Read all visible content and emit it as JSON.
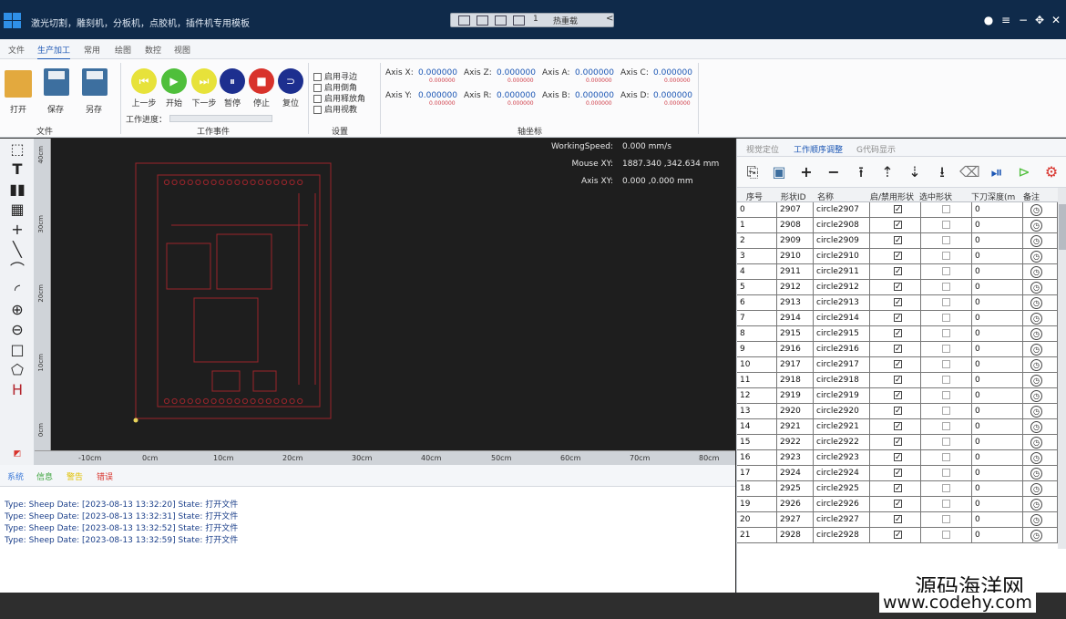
{
  "window": {
    "title": "激光切割，雕刻机，分板机，点胶机，插件机专用模板",
    "quick_count": "1",
    "quick_reload": "热重载",
    "quick_collapse": "<"
  },
  "menu": [
    "文件",
    "生产加工",
    "常用",
    "绘图",
    "数控",
    "视图"
  ],
  "menu_active": "生产加工",
  "ribbon": {
    "file_group": {
      "label": "文件",
      "buttons": [
        "打开",
        "保存",
        "另存"
      ]
    },
    "work_group": {
      "label": "工作事件",
      "buttons": [
        {
          "label": "上一步",
          "icon": "skip-back-icon",
          "color": "#e7e23a"
        },
        {
          "label": "开始",
          "icon": "play-icon",
          "color": "#4fbf3b"
        },
        {
          "label": "下一步",
          "icon": "skip-forward-icon",
          "color": "#e7e23a"
        },
        {
          "label": "暂停",
          "icon": "pause-icon",
          "color": "#1d2f8f"
        },
        {
          "label": "停止",
          "icon": "stop-icon",
          "color": "#d8322b"
        },
        {
          "label": "复位",
          "icon": "reset-icon",
          "color": "#1d2f8f"
        }
      ],
      "progress_label": "工作进度：",
      "progress": 0
    },
    "settings_group": {
      "label": "设置",
      "options": [
        "启用寻边",
        "启用倒角",
        "启用释放角",
        "启用视教"
      ]
    },
    "axis_group": {
      "label": "轴坐标",
      "axes": [
        {
          "name": "Axis X:",
          "value": "0.000000",
          "sub": "0.000000"
        },
        {
          "name": "Axis Z:",
          "value": "0.000000",
          "sub": "0.000000"
        },
        {
          "name": "Axis A:",
          "value": "0.000000",
          "sub": "0.000000"
        },
        {
          "name": "Axis C:",
          "value": "0.000000",
          "sub": "0.000000"
        },
        {
          "name": "Axis Y:",
          "value": "0.000000",
          "sub": "0.000000"
        },
        {
          "name": "Axis R:",
          "value": "0.000000",
          "sub": "0.000000"
        },
        {
          "name": "Axis B:",
          "value": "0.000000",
          "sub": "0.000000"
        },
        {
          "name": "Axis D:",
          "value": "0.000000",
          "sub": "0.000000"
        }
      ]
    }
  },
  "left_tools": [
    "select-icon",
    "text-icon",
    "barcode-icon",
    "qrcode-icon",
    "point-icon",
    "line-icon",
    "polyline-icon",
    "arc-icon",
    "circle-icon",
    "ellipse-icon",
    "rectangle-icon",
    "polygon-icon",
    "dimension-icon"
  ],
  "canvas": {
    "hud": [
      {
        "key": "WorkingSpeed:",
        "value": "0.000 mm/s"
      },
      {
        "key": "Mouse XY:",
        "value": "1887.340 ,342.634 mm"
      },
      {
        "key": "Axis XY:",
        "value": "0.000 ,0.000 mm"
      }
    ],
    "h_ruler": [
      "-10cm",
      "0cm",
      "10cm",
      "20cm",
      "30cm",
      "40cm",
      "50cm",
      "60cm",
      "70cm",
      "80cm"
    ],
    "v_ruler": [
      "40cm",
      "30cm",
      "20cm",
      "10cm",
      "0cm"
    ]
  },
  "log": {
    "tabs": [
      {
        "label": "系统",
        "color": "#3a78d8"
      },
      {
        "label": "信息",
        "color": "#3aa33a"
      },
      {
        "label": "警告",
        "color": "#e0c000"
      },
      {
        "label": "错误",
        "color": "#d8322b"
      }
    ],
    "lines": [
      "Type: Sheep  Date: [2023-08-13 13:32:20]  State: 打开文件",
      "Type: Sheep  Date: [2023-08-13 13:32:31]  State: 打开文件",
      "Type: Sheep  Date: [2023-08-13 13:32:52]  State: 打开文件",
      "Type: Sheep  Date: [2023-08-13 13:32:59]  State: 打开文件"
    ]
  },
  "right_panel": {
    "tabs": [
      "视觉定位",
      "工作顺序调整",
      "G代码显示"
    ],
    "active_tab": "工作顺序调整",
    "tools": [
      "new-icon",
      "save-icon",
      "plus-icon",
      "minus-icon",
      "move-top-icon",
      "move-up-icon",
      "move-down-icon",
      "move-bottom-icon",
      "eraser-icon",
      "step-icon",
      "run-icon",
      "settings-icon"
    ],
    "columns": [
      "序号",
      "形状ID",
      "名称",
      "启/禁用形状",
      "选中形状",
      "下刀深度(m",
      "备注"
    ],
    "rows": [
      {
        "idx": "0",
        "id": "2907",
        "name": "circle2907",
        "enabled": true,
        "selected": false,
        "depth": "0"
      },
      {
        "idx": "1",
        "id": "2908",
        "name": "circle2908",
        "enabled": true,
        "selected": false,
        "depth": "0"
      },
      {
        "idx": "2",
        "id": "2909",
        "name": "circle2909",
        "enabled": true,
        "selected": false,
        "depth": "0"
      },
      {
        "idx": "3",
        "id": "2910",
        "name": "circle2910",
        "enabled": true,
        "selected": false,
        "depth": "0"
      },
      {
        "idx": "4",
        "id": "2911",
        "name": "circle2911",
        "enabled": true,
        "selected": false,
        "depth": "0"
      },
      {
        "idx": "5",
        "id": "2912",
        "name": "circle2912",
        "enabled": true,
        "selected": false,
        "depth": "0"
      },
      {
        "idx": "6",
        "id": "2913",
        "name": "circle2913",
        "enabled": true,
        "selected": false,
        "depth": "0"
      },
      {
        "idx": "7",
        "id": "2914",
        "name": "circle2914",
        "enabled": true,
        "selected": false,
        "depth": "0"
      },
      {
        "idx": "8",
        "id": "2915",
        "name": "circle2915",
        "enabled": true,
        "selected": false,
        "depth": "0"
      },
      {
        "idx": "9",
        "id": "2916",
        "name": "circle2916",
        "enabled": true,
        "selected": false,
        "depth": "0"
      },
      {
        "idx": "10",
        "id": "2917",
        "name": "circle2917",
        "enabled": true,
        "selected": false,
        "depth": "0"
      },
      {
        "idx": "11",
        "id": "2918",
        "name": "circle2918",
        "enabled": true,
        "selected": false,
        "depth": "0"
      },
      {
        "idx": "12",
        "id": "2919",
        "name": "circle2919",
        "enabled": true,
        "selected": false,
        "depth": "0"
      },
      {
        "idx": "13",
        "id": "2920",
        "name": "circle2920",
        "enabled": true,
        "selected": false,
        "depth": "0"
      },
      {
        "idx": "14",
        "id": "2921",
        "name": "circle2921",
        "enabled": true,
        "selected": false,
        "depth": "0"
      },
      {
        "idx": "15",
        "id": "2922",
        "name": "circle2922",
        "enabled": true,
        "selected": false,
        "depth": "0"
      },
      {
        "idx": "16",
        "id": "2923",
        "name": "circle2923",
        "enabled": true,
        "selected": false,
        "depth": "0"
      },
      {
        "idx": "17",
        "id": "2924",
        "name": "circle2924",
        "enabled": true,
        "selected": false,
        "depth": "0"
      },
      {
        "idx": "18",
        "id": "2925",
        "name": "circle2925",
        "enabled": true,
        "selected": false,
        "depth": "0"
      },
      {
        "idx": "19",
        "id": "2926",
        "name": "circle2926",
        "enabled": true,
        "selected": false,
        "depth": "0"
      },
      {
        "idx": "20",
        "id": "2927",
        "name": "circle2927",
        "enabled": true,
        "selected": false,
        "depth": "0"
      },
      {
        "idx": "21",
        "id": "2928",
        "name": "circle2928",
        "enabled": true,
        "selected": false,
        "depth": "0"
      }
    ]
  },
  "watermark": {
    "cn": "源码海洋网",
    "url": "www.codehy.com"
  },
  "colors": {
    "accent": "#1b56b4",
    "titlebar": "#0f2a4a",
    "drawing": "#b3262e"
  }
}
